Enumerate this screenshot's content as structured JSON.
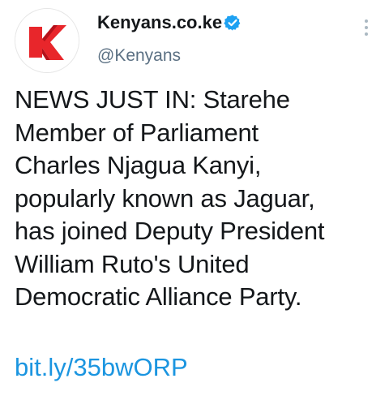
{
  "author": {
    "display_name": "Kenyans.co.ke",
    "handle": "@Kenyans",
    "verified": true,
    "avatar_icon": "kenyans-k-logo",
    "brand_color": "#e8262b"
  },
  "tweet": {
    "lines": [
      "NEWS JUST IN: Starehe",
      "Member of Parliament",
      "Charles Njagua Kanyi,",
      "popularly known as Jaguar,",
      "has joined Deputy President",
      "William Ruto's United",
      "Democratic Alliance Party."
    ],
    "link": "bit.ly/35bwORP"
  },
  "icons": {
    "more": "more-vertical-icon",
    "verified": "verified-badge-icon"
  },
  "colors": {
    "link": "#1b95e0",
    "verified": "#1da1f2",
    "secondary_text": "#5b7083"
  }
}
